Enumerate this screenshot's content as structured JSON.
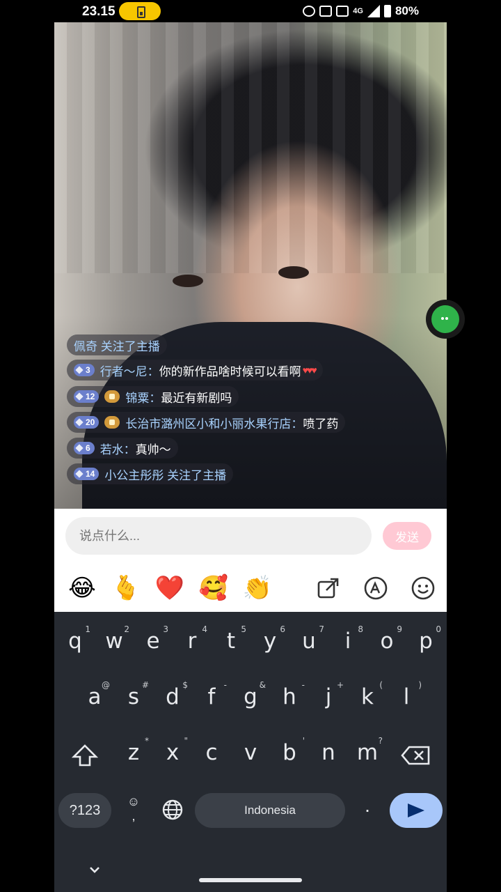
{
  "status_bar": {
    "time": "23.15",
    "network": "4G",
    "battery": "80%"
  },
  "chat": [
    {
      "id": "c1",
      "text": "佩奇 关注了主播",
      "type": "follow"
    },
    {
      "id": "c2",
      "level": "3",
      "user": "行者～尼：",
      "message": "你的新作品啥时候可以看啊"
    },
    {
      "id": "c3",
      "level": "12",
      "user": "锦粟：",
      "message": "最近有新剧吗",
      "fan_badge": true
    },
    {
      "id": "c4",
      "level": "20",
      "user": "长治市潞州区小和小丽水果行店：",
      "message": "喷了药",
      "fan_badge": true
    },
    {
      "id": "c5",
      "level": "6",
      "user": "若水：",
      "message": "真帅～"
    },
    {
      "id": "c6",
      "level": "14",
      "text": "小公主彤彤 关注了主播",
      "type": "follow"
    }
  ],
  "composer": {
    "placeholder": "说点什么...",
    "send_label": "发送"
  },
  "emoji_bar": {
    "emojis": [
      "😂",
      "🫰",
      "❤️",
      "🥰",
      "👏"
    ],
    "tools": [
      "share-icon",
      "font-style-icon",
      "emoji-panel-icon"
    ]
  },
  "keyboard": {
    "row1": [
      [
        "q",
        "1"
      ],
      [
        "w",
        "2"
      ],
      [
        "e",
        "3"
      ],
      [
        "r",
        "4"
      ],
      [
        "t",
        "5"
      ],
      [
        "y",
        "6"
      ],
      [
        "u",
        "7"
      ],
      [
        "i",
        "8"
      ],
      [
        "o",
        "9"
      ],
      [
        "p",
        "0"
      ]
    ],
    "row2": [
      [
        "a",
        "@"
      ],
      [
        "s",
        "#"
      ],
      [
        "d",
        "$"
      ],
      [
        "f",
        "-"
      ],
      [
        "g",
        "&"
      ],
      [
        "h",
        "-"
      ],
      [
        "j",
        "+"
      ],
      [
        "k",
        "("
      ],
      [
        "l",
        ")"
      ]
    ],
    "row3": [
      [
        "z",
        "*"
      ],
      [
        "x",
        "\""
      ],
      [
        "c",
        ""
      ],
      [
        "v",
        ""
      ],
      [
        "b",
        "'"
      ],
      [
        "n",
        ""
      ],
      [
        "m",
        "?"
      ]
    ],
    "sym_label": "?123",
    "space_label": "Indonesia",
    "period": "."
  },
  "colors": {
    "send_disabled": "#ffc9d4",
    "keyboard_bg": "#262a31",
    "enter_key": "#a8c7fa",
    "username": "#a9d3ff"
  }
}
